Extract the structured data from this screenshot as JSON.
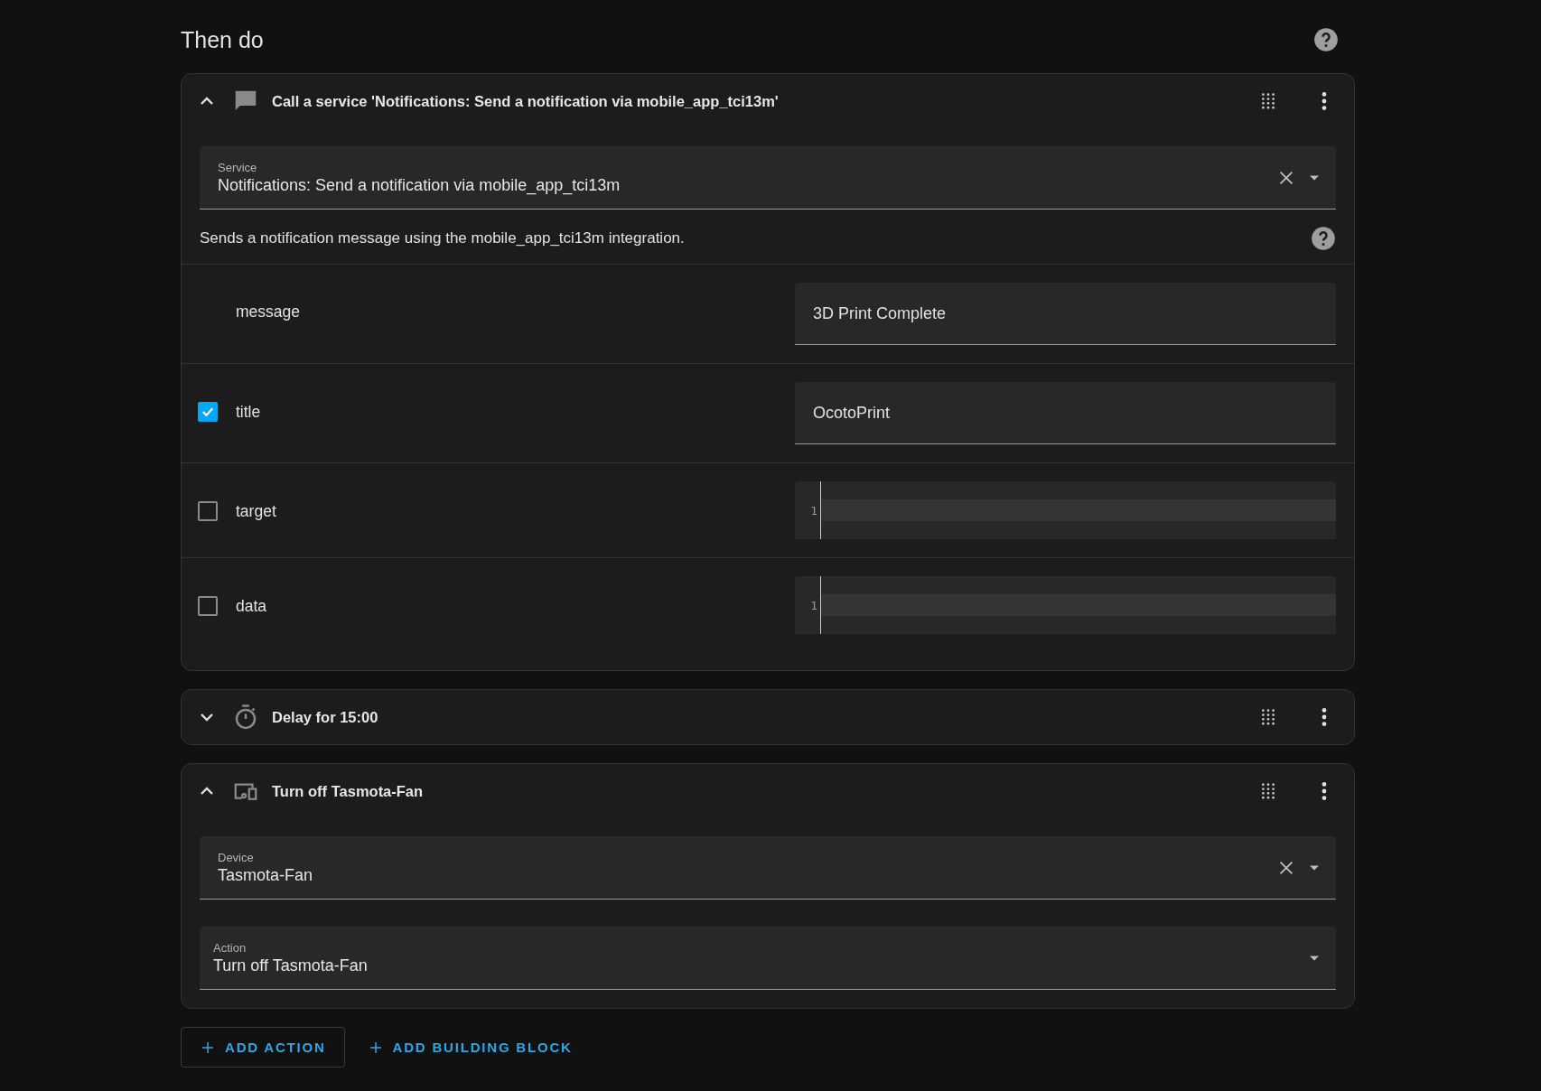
{
  "title": "Then do",
  "actions": [
    {
      "kind": "service",
      "expanded": true,
      "title": "Call a service 'Notifications: Send a notification via mobile_app_tci13m'",
      "selects": [
        {
          "label": "Service",
          "value": "Notifications: Send a notification via mobile_app_tci13m",
          "clearable": true
        }
      ],
      "description": "Sends a notification message using the mobile_app_tci13m integration.",
      "fields": [
        {
          "name": "message",
          "kind": "text",
          "value": "3D Print Complete"
        },
        {
          "name": "title",
          "checked": true,
          "kind": "text",
          "value": "OcotoPrint"
        },
        {
          "name": "target",
          "checked": false,
          "kind": "code",
          "line": "1"
        },
        {
          "name": "data",
          "checked": false,
          "kind": "code",
          "line": "1"
        }
      ]
    },
    {
      "kind": "delay",
      "expanded": false,
      "title": "Delay for 15:00"
    },
    {
      "kind": "device",
      "expanded": true,
      "title": "Turn off Tasmota-Fan",
      "selects": [
        {
          "label": "Device",
          "value": "Tasmota-Fan",
          "clearable": true
        },
        {
          "label": "Action",
          "value": "Turn off Tasmota-Fan",
          "clearable": false
        }
      ]
    }
  ],
  "buttons": [
    {
      "label": "ADD ACTION",
      "outlined": true
    },
    {
      "label": "ADD BUILDING BLOCK",
      "outlined": false
    }
  ]
}
